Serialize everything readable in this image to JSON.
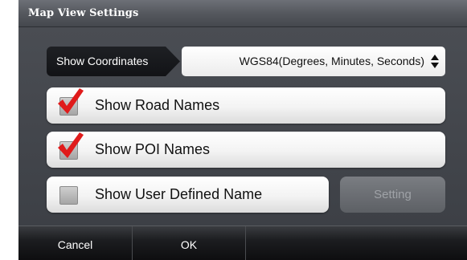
{
  "window": {
    "title": "Map View Settings"
  },
  "coordinates": {
    "label": "Show Coordinates",
    "value": "WGS84(Degrees, Minutes, Seconds)",
    "icon": "updown-arrows-icon"
  },
  "options": [
    {
      "label": "Show Road Names",
      "checked": true
    },
    {
      "label": "Show POI Names",
      "checked": true
    },
    {
      "label": "Show User Defined Name",
      "checked": false
    }
  ],
  "setting_button": {
    "label": "Setting",
    "enabled": false
  },
  "footer": {
    "cancel_label": "Cancel",
    "ok_label": "OK"
  },
  "colors": {
    "check_mark": "#e01b1b",
    "background": "#3d4046",
    "disabled_text": "#9fa2a7"
  }
}
